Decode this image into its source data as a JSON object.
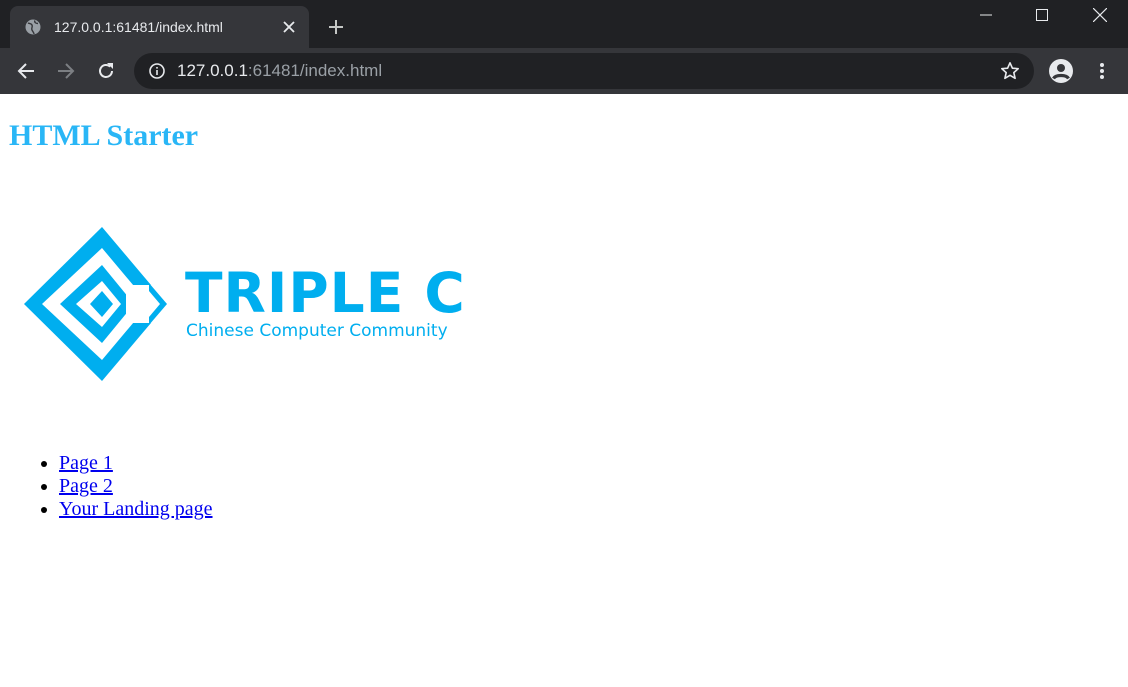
{
  "colors": {
    "accent": "#29b6f6",
    "logo_blue": "#00aeef",
    "link": "#0000ee",
    "chrome_dark": "#202124",
    "chrome_tab": "#35363a"
  },
  "browser": {
    "tab_title": "127.0.0.1:61481/index.html",
    "favicon_icon": "globe-icon",
    "url_host": "127.0.0.1",
    "url_rest": ":61481/index.html"
  },
  "page": {
    "title": "HTML Starter",
    "logo": {
      "main_text": "TRIPLE C",
      "sub_text": "Chinese Computer Community"
    },
    "links": [
      {
        "label": "Page 1"
      },
      {
        "label": "Page 2"
      },
      {
        "label": "Your Landing page"
      }
    ]
  }
}
